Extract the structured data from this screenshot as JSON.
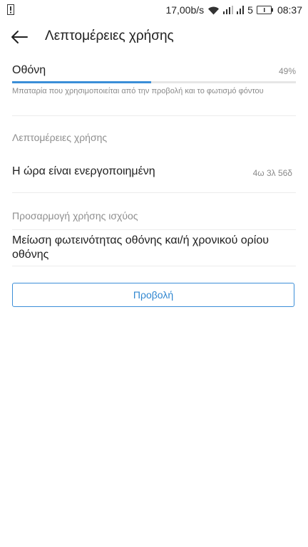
{
  "status_bar": {
    "network_speed": "17,00b/s",
    "sim_slot": "5",
    "time": "08:37"
  },
  "app_bar": {
    "title": "Λεπτομέρειες χρήσης"
  },
  "usage_item": {
    "name": "Οθόνη",
    "percent_label": "49%",
    "percent_value": 0.49,
    "description": "Μπαταρία που χρησιμοποιείται από την προβολή και το φωτισμό φόντου"
  },
  "details_section": {
    "header": "Λεπτομέρειες χρήσης",
    "time_on_label": "Η ώρα είναι ενεργοποιημένη",
    "time_on_value": "4ω 3λ 56δ"
  },
  "adjust_section": {
    "header": "Προσαρμογή χρήσης ισχύος",
    "tip": "Μείωση φωτεινότητας οθόνης και/ή χρονικού ορίου οθόνης",
    "view_button_label": "Προβολή"
  },
  "colors": {
    "accent": "#3b8ed8",
    "secondary_text": "#8a8a8a",
    "primary_text": "#212121"
  }
}
